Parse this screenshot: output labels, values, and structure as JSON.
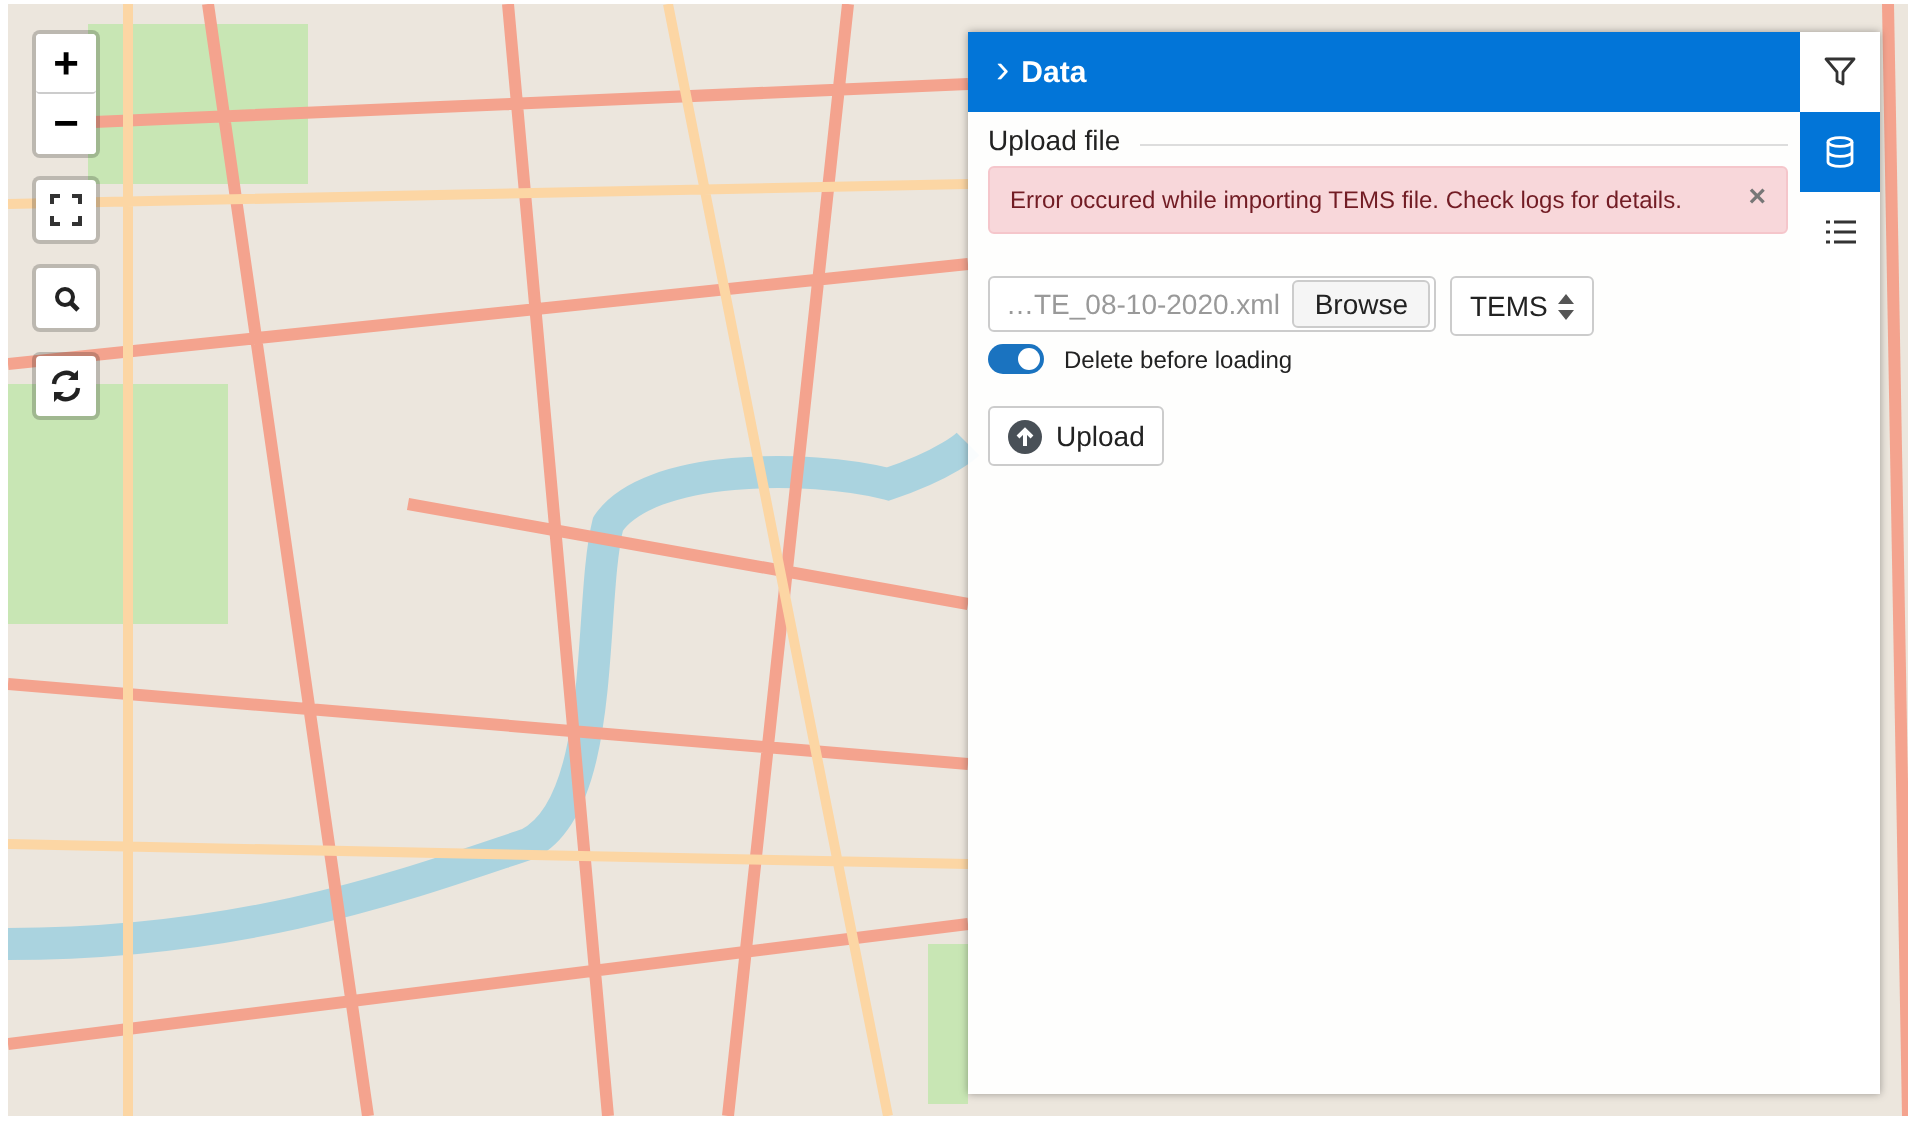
{
  "map_controls": {
    "zoom_in": "+",
    "zoom_out": "−"
  },
  "panel": {
    "header": {
      "chevron": "›",
      "title": "Data",
      "expanded": true
    },
    "section_title": "Upload file",
    "alert": {
      "message": "Error occured while importing TEMS file. Check logs for details.",
      "close": "×"
    },
    "file_field": {
      "value": "…TE_08-10-2020.xml",
      "button": "Browse"
    },
    "format_select": {
      "value": "TEMS"
    },
    "toggle": {
      "label": "Delete before loading",
      "checked": true
    },
    "upload_button": "Upload"
  },
  "side_tabs": [
    {
      "kind": "filter",
      "selected": false
    },
    {
      "kind": "database",
      "selected": true
    },
    {
      "kind": "list",
      "selected": false
    }
  ]
}
